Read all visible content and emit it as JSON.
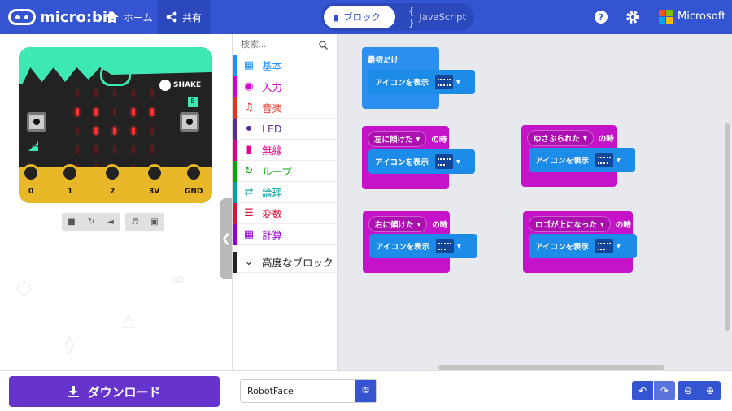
{
  "app": {
    "name": "micro:bit"
  },
  "nav": {
    "home": "ホーム",
    "share": "共有"
  },
  "editor_toggle": {
    "blocks": "ブロック",
    "javascript": "JavaScript"
  },
  "header_right": {
    "microsoft": "Microsoft"
  },
  "simulator": {
    "shake": "SHAKE",
    "btn_a": "A",
    "btn_b": "B",
    "pins": [
      "0",
      "1",
      "2",
      "3V",
      "GND"
    ]
  },
  "toolbox": {
    "search_placeholder": "検索...",
    "categories": [
      {
        "label": "基本",
        "color": "#1e90ff"
      },
      {
        "label": "入力",
        "color": "#d400d4"
      },
      {
        "label": "音楽",
        "color": "#e63022"
      },
      {
        "label": "LED",
        "color": "#5c2d91"
      },
      {
        "label": "無線",
        "color": "#e3008c"
      },
      {
        "label": "ループ",
        "color": "#00aa00"
      },
      {
        "label": "論理",
        "color": "#00a4a6"
      },
      {
        "label": "変数",
        "color": "#dc143c"
      },
      {
        "label": "計算",
        "color": "#9400d3"
      },
      {
        "label": "高度なブロック",
        "color": "#222222"
      }
    ]
  },
  "workspace": {
    "blocks": [
      {
        "hat": "最初だけ",
        "cmd": "アイコンを表示"
      },
      {
        "hat": "左に傾けた",
        "suffix": "の時",
        "cmd": "アイコンを表示"
      },
      {
        "hat": "ゆさぶられた",
        "suffix": "の時",
        "cmd": "アイコンを表示"
      },
      {
        "hat": "右に傾けた",
        "suffix": "の時",
        "cmd": "アイコンを表示"
      },
      {
        "hat": "ロゴが上になった",
        "suffix": "の時",
        "cmd": "アイコンを表示"
      }
    ]
  },
  "bottom": {
    "download": "ダウンロード",
    "project_name": "RobotFace"
  }
}
